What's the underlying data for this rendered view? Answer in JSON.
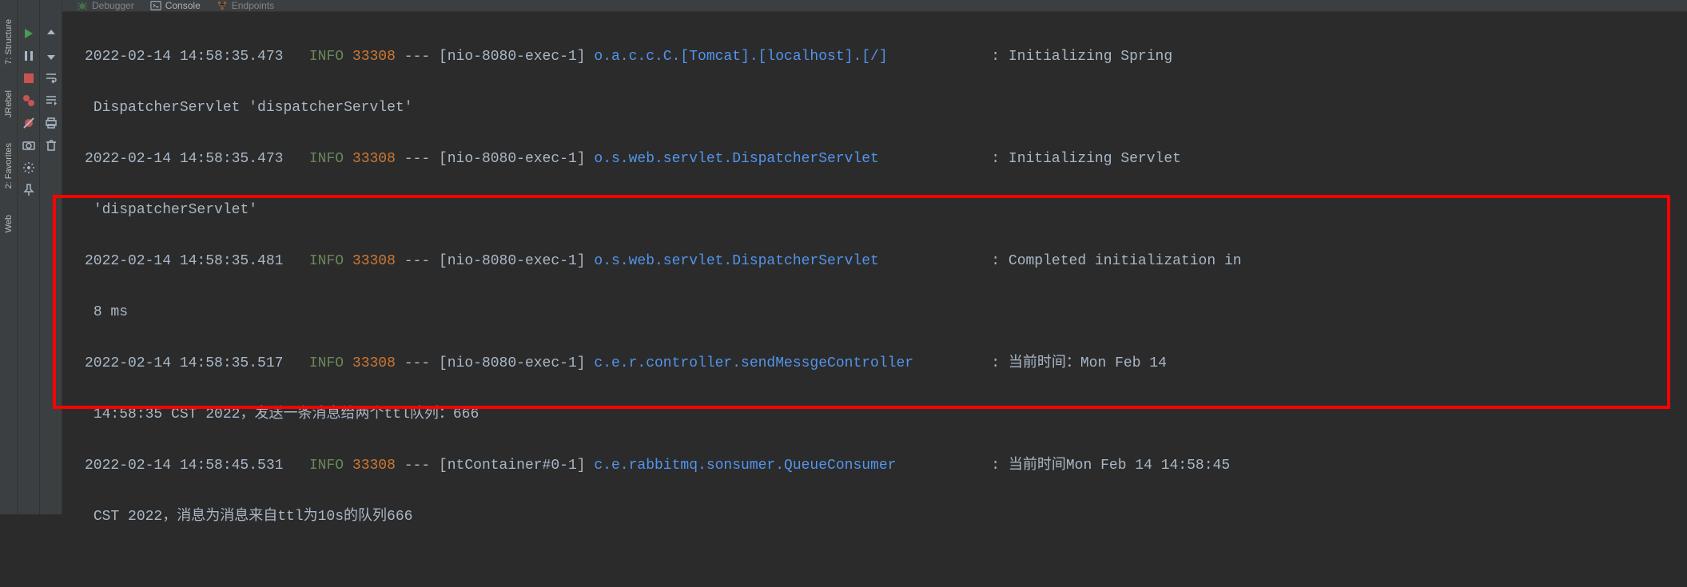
{
  "toolwindows": {
    "structure": "7: Structure",
    "jrebel": "JRebel",
    "favorites": "2: Favorites",
    "web": "Web"
  },
  "tabs": {
    "debugger": "Debugger",
    "console": "Console",
    "endpoints": "Endpoints"
  },
  "log": [
    {
      "ts": "2022-02-14 14:58:35.473",
      "level": "INFO",
      "pid": "33308",
      "sep": "---",
      "thread": "[nio-8080-exec-1]",
      "logger": "o.a.c.c.C.[Tomcat].[localhost].[/]",
      "msg": ": Initializing Spring",
      "cont": "DispatcherServlet 'dispatcherServlet'"
    },
    {
      "ts": "2022-02-14 14:58:35.473",
      "level": "INFO",
      "pid": "33308",
      "sep": "---",
      "thread": "[nio-8080-exec-1]",
      "logger": "o.s.web.servlet.DispatcherServlet",
      "msg": ": Initializing Servlet",
      "cont": "'dispatcherServlet'"
    },
    {
      "ts": "2022-02-14 14:58:35.481",
      "level": "INFO",
      "pid": "33308",
      "sep": "---",
      "thread": "[nio-8080-exec-1]",
      "logger": "o.s.web.servlet.DispatcherServlet",
      "msg": ": Completed initialization in",
      "cont": "8 ms"
    },
    {
      "ts": "2022-02-14 14:58:35.517",
      "level": "INFO",
      "pid": "33308",
      "sep": "---",
      "thread": "[nio-8080-exec-1]",
      "logger": "c.e.r.controller.sendMessgeController",
      "msg": ": 当前时间：Mon Feb 14",
      "cont": "14:58:35 CST 2022，发送一条消息给两个ttl队列：666"
    },
    {
      "ts": "2022-02-14 14:58:45.531",
      "level": "INFO",
      "pid": "33308",
      "sep": "---",
      "thread": "[ntContainer#0-1]",
      "logger": "c.e.rabbitmq.sonsumer.QueueConsumer",
      "msg": ": 当前时间Mon Feb 14 14:58:45",
      "cont": "CST 2022，消息为消息来自ttl为10s的队列666"
    }
  ],
  "colors": {
    "bg": "#2b2b2b",
    "panel": "#3c3f41",
    "info": "#6a8759",
    "pid": "#cc7832",
    "logger": "#5394ec",
    "text": "#a9b7c6",
    "highlight": "#ff0000"
  }
}
